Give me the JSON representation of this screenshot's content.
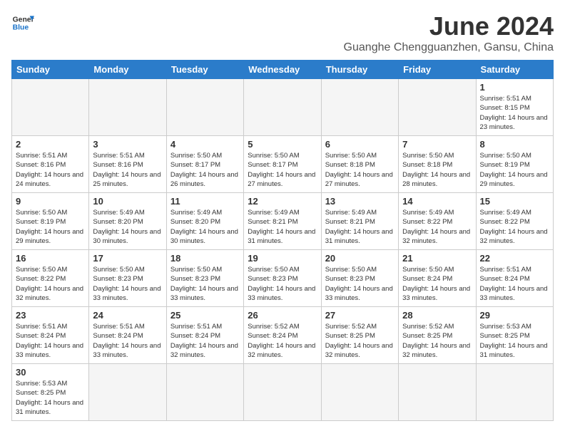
{
  "header": {
    "logo_general": "General",
    "logo_blue": "Blue",
    "month_title": "June 2024",
    "subtitle": "Guanghe Chengguanzhen, Gansu, China"
  },
  "weekdays": [
    "Sunday",
    "Monday",
    "Tuesday",
    "Wednesday",
    "Thursday",
    "Friday",
    "Saturday"
  ],
  "weeks": [
    [
      {
        "day": "",
        "sunrise": "",
        "sunset": "",
        "daylight": ""
      },
      {
        "day": "",
        "sunrise": "",
        "sunset": "",
        "daylight": ""
      },
      {
        "day": "",
        "sunrise": "",
        "sunset": "",
        "daylight": ""
      },
      {
        "day": "",
        "sunrise": "",
        "sunset": "",
        "daylight": ""
      },
      {
        "day": "",
        "sunrise": "",
        "sunset": "",
        "daylight": ""
      },
      {
        "day": "",
        "sunrise": "",
        "sunset": "",
        "daylight": ""
      },
      {
        "day": "1",
        "sunrise": "Sunrise: 5:51 AM",
        "sunset": "Sunset: 8:15 PM",
        "daylight": "Daylight: 14 hours and 23 minutes."
      }
    ],
    [
      {
        "day": "2",
        "sunrise": "Sunrise: 5:51 AM",
        "sunset": "Sunset: 8:16 PM",
        "daylight": "Daylight: 14 hours and 24 minutes."
      },
      {
        "day": "3",
        "sunrise": "Sunrise: 5:51 AM",
        "sunset": "Sunset: 8:16 PM",
        "daylight": "Daylight: 14 hours and 25 minutes."
      },
      {
        "day": "4",
        "sunrise": "Sunrise: 5:50 AM",
        "sunset": "Sunset: 8:17 PM",
        "daylight": "Daylight: 14 hours and 26 minutes."
      },
      {
        "day": "5",
        "sunrise": "Sunrise: 5:50 AM",
        "sunset": "Sunset: 8:17 PM",
        "daylight": "Daylight: 14 hours and 27 minutes."
      },
      {
        "day": "6",
        "sunrise": "Sunrise: 5:50 AM",
        "sunset": "Sunset: 8:18 PM",
        "daylight": "Daylight: 14 hours and 27 minutes."
      },
      {
        "day": "7",
        "sunrise": "Sunrise: 5:50 AM",
        "sunset": "Sunset: 8:18 PM",
        "daylight": "Daylight: 14 hours and 28 minutes."
      },
      {
        "day": "8",
        "sunrise": "Sunrise: 5:50 AM",
        "sunset": "Sunset: 8:19 PM",
        "daylight": "Daylight: 14 hours and 29 minutes."
      }
    ],
    [
      {
        "day": "9",
        "sunrise": "Sunrise: 5:50 AM",
        "sunset": "Sunset: 8:19 PM",
        "daylight": "Daylight: 14 hours and 29 minutes."
      },
      {
        "day": "10",
        "sunrise": "Sunrise: 5:49 AM",
        "sunset": "Sunset: 8:20 PM",
        "daylight": "Daylight: 14 hours and 30 minutes."
      },
      {
        "day": "11",
        "sunrise": "Sunrise: 5:49 AM",
        "sunset": "Sunset: 8:20 PM",
        "daylight": "Daylight: 14 hours and 30 minutes."
      },
      {
        "day": "12",
        "sunrise": "Sunrise: 5:49 AM",
        "sunset": "Sunset: 8:21 PM",
        "daylight": "Daylight: 14 hours and 31 minutes."
      },
      {
        "day": "13",
        "sunrise": "Sunrise: 5:49 AM",
        "sunset": "Sunset: 8:21 PM",
        "daylight": "Daylight: 14 hours and 31 minutes."
      },
      {
        "day": "14",
        "sunrise": "Sunrise: 5:49 AM",
        "sunset": "Sunset: 8:22 PM",
        "daylight": "Daylight: 14 hours and 32 minutes."
      },
      {
        "day": "15",
        "sunrise": "Sunrise: 5:49 AM",
        "sunset": "Sunset: 8:22 PM",
        "daylight": "Daylight: 14 hours and 32 minutes."
      }
    ],
    [
      {
        "day": "16",
        "sunrise": "Sunrise: 5:50 AM",
        "sunset": "Sunset: 8:22 PM",
        "daylight": "Daylight: 14 hours and 32 minutes."
      },
      {
        "day": "17",
        "sunrise": "Sunrise: 5:50 AM",
        "sunset": "Sunset: 8:23 PM",
        "daylight": "Daylight: 14 hours and 33 minutes."
      },
      {
        "day": "18",
        "sunrise": "Sunrise: 5:50 AM",
        "sunset": "Sunset: 8:23 PM",
        "daylight": "Daylight: 14 hours and 33 minutes."
      },
      {
        "day": "19",
        "sunrise": "Sunrise: 5:50 AM",
        "sunset": "Sunset: 8:23 PM",
        "daylight": "Daylight: 14 hours and 33 minutes."
      },
      {
        "day": "20",
        "sunrise": "Sunrise: 5:50 AM",
        "sunset": "Sunset: 8:23 PM",
        "daylight": "Daylight: 14 hours and 33 minutes."
      },
      {
        "day": "21",
        "sunrise": "Sunrise: 5:50 AM",
        "sunset": "Sunset: 8:24 PM",
        "daylight": "Daylight: 14 hours and 33 minutes."
      },
      {
        "day": "22",
        "sunrise": "Sunrise: 5:51 AM",
        "sunset": "Sunset: 8:24 PM",
        "daylight": "Daylight: 14 hours and 33 minutes."
      }
    ],
    [
      {
        "day": "23",
        "sunrise": "Sunrise: 5:51 AM",
        "sunset": "Sunset: 8:24 PM",
        "daylight": "Daylight: 14 hours and 33 minutes."
      },
      {
        "day": "24",
        "sunrise": "Sunrise: 5:51 AM",
        "sunset": "Sunset: 8:24 PM",
        "daylight": "Daylight: 14 hours and 33 minutes."
      },
      {
        "day": "25",
        "sunrise": "Sunrise: 5:51 AM",
        "sunset": "Sunset: 8:24 PM",
        "daylight": "Daylight: 14 hours and 32 minutes."
      },
      {
        "day": "26",
        "sunrise": "Sunrise: 5:52 AM",
        "sunset": "Sunset: 8:24 PM",
        "daylight": "Daylight: 14 hours and 32 minutes."
      },
      {
        "day": "27",
        "sunrise": "Sunrise: 5:52 AM",
        "sunset": "Sunset: 8:25 PM",
        "daylight": "Daylight: 14 hours and 32 minutes."
      },
      {
        "day": "28",
        "sunrise": "Sunrise: 5:52 AM",
        "sunset": "Sunset: 8:25 PM",
        "daylight": "Daylight: 14 hours and 32 minutes."
      },
      {
        "day": "29",
        "sunrise": "Sunrise: 5:53 AM",
        "sunset": "Sunset: 8:25 PM",
        "daylight": "Daylight: 14 hours and 31 minutes."
      }
    ],
    [
      {
        "day": "30",
        "sunrise": "Sunrise: 5:53 AM",
        "sunset": "Sunset: 8:25 PM",
        "daylight": "Daylight: 14 hours and 31 minutes."
      },
      {
        "day": "",
        "sunrise": "",
        "sunset": "",
        "daylight": ""
      },
      {
        "day": "",
        "sunrise": "",
        "sunset": "",
        "daylight": ""
      },
      {
        "day": "",
        "sunrise": "",
        "sunset": "",
        "daylight": ""
      },
      {
        "day": "",
        "sunrise": "",
        "sunset": "",
        "daylight": ""
      },
      {
        "day": "",
        "sunrise": "",
        "sunset": "",
        "daylight": ""
      },
      {
        "day": "",
        "sunrise": "",
        "sunset": "",
        "daylight": ""
      }
    ]
  ]
}
